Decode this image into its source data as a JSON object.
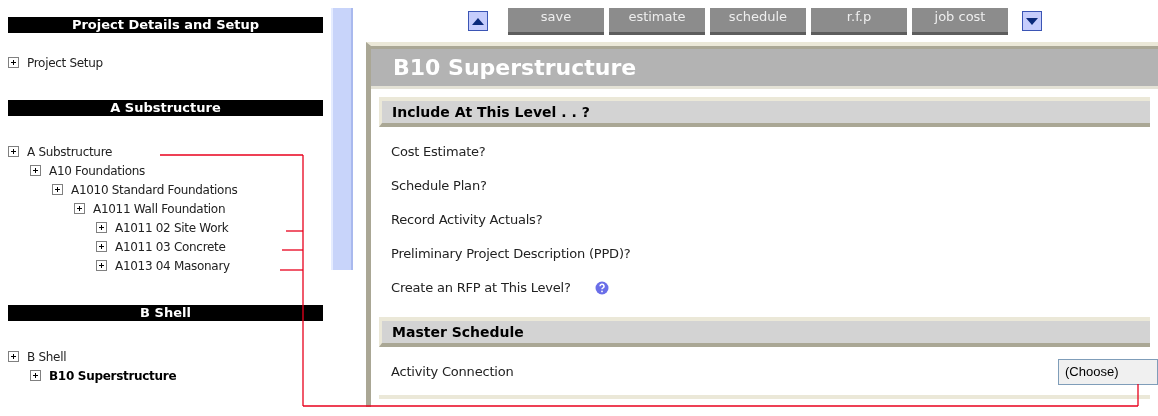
{
  "sidebar": {
    "sections": [
      {
        "title": "Project Details and Setup",
        "items": [
          {
            "label": "Project Setup",
            "selected": false
          }
        ]
      },
      {
        "title": "A Substructure",
        "items": [
          {
            "label": "A Substructure",
            "selected": false,
            "children": [
              {
                "label": "A10 Foundations",
                "selected": false,
                "children": [
                  {
                    "label": "A1010 Standard Foundations",
                    "selected": false,
                    "children": [
                      {
                        "label": "A1011 Wall Foundation",
                        "selected": false,
                        "children": [
                          {
                            "label": "A1011 02 Site Work",
                            "selected": false
                          },
                          {
                            "label": "A1011 03 Concrete",
                            "selected": false
                          },
                          {
                            "label": "A1013 04 Masonary",
                            "selected": false
                          }
                        ]
                      }
                    ]
                  }
                ]
              }
            ]
          }
        ]
      },
      {
        "title": "B Shell",
        "items": [
          {
            "label": "B Shell",
            "selected": false,
            "children": [
              {
                "label": "B10 Superstructure",
                "selected": true
              }
            ]
          }
        ]
      }
    ]
  },
  "toolbar": {
    "buttons": [
      "save",
      "estimate",
      "schedule",
      "r.f.p",
      "job cost"
    ]
  },
  "panel": {
    "title": "B10 Superstructure",
    "sections": [
      {
        "title": "Include At This Level . . ?",
        "rows": [
          {
            "label": "Cost Estimate?",
            "kind": "text"
          },
          {
            "label": "Schedule Plan?",
            "kind": "text"
          },
          {
            "label": "Record Activity Actuals?",
            "kind": "text"
          },
          {
            "label": "Preliminary Project Description (PPD)?",
            "kind": "text"
          },
          {
            "label": "Create an RFP at This Level?",
            "kind": "help"
          }
        ]
      },
      {
        "title": "Master Schedule",
        "rows": [
          {
            "label": "Activity Connection",
            "kind": "select",
            "value": "(Choose)"
          }
        ]
      }
    ]
  }
}
